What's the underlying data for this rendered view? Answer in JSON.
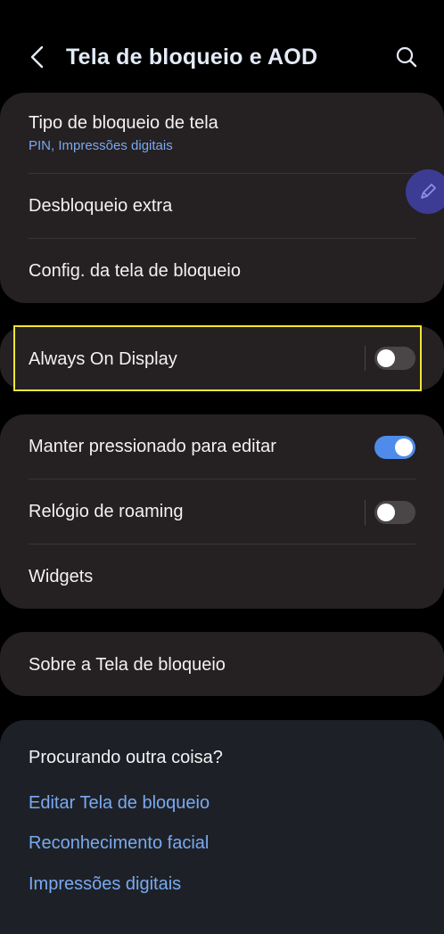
{
  "header": {
    "title": "Tela de bloqueio e AOD",
    "back_icon": "chevron-left-icon",
    "search_icon": "search-icon"
  },
  "lock_section": {
    "items": [
      {
        "label": "Tipo de bloqueio de tela",
        "sublabel": "PIN, Impressões digitais"
      },
      {
        "label": "Desbloqueio extra"
      },
      {
        "label": "Config. da tela de bloqueio"
      }
    ]
  },
  "aod": {
    "label": "Always On Display",
    "toggle_on": false
  },
  "options_section": {
    "items": [
      {
        "label": "Manter pressionado para editar",
        "toggle_on": true
      },
      {
        "label": "Relógio de roaming",
        "toggle_on": false
      },
      {
        "label": "Widgets"
      }
    ]
  },
  "about": {
    "label": "Sobre a Tela de bloqueio"
  },
  "suggestions": {
    "title": "Procurando outra coisa?",
    "links": [
      "Editar Tela de bloqueio",
      "Reconhecimento facial",
      "Impressões digitais"
    ]
  },
  "fab": {
    "icon": "pen-icon"
  },
  "colors": {
    "accent": "#4f8bea",
    "link": "#7aa9f0",
    "highlight": "#f2e633",
    "card": "#252022",
    "background": "#000000"
  }
}
